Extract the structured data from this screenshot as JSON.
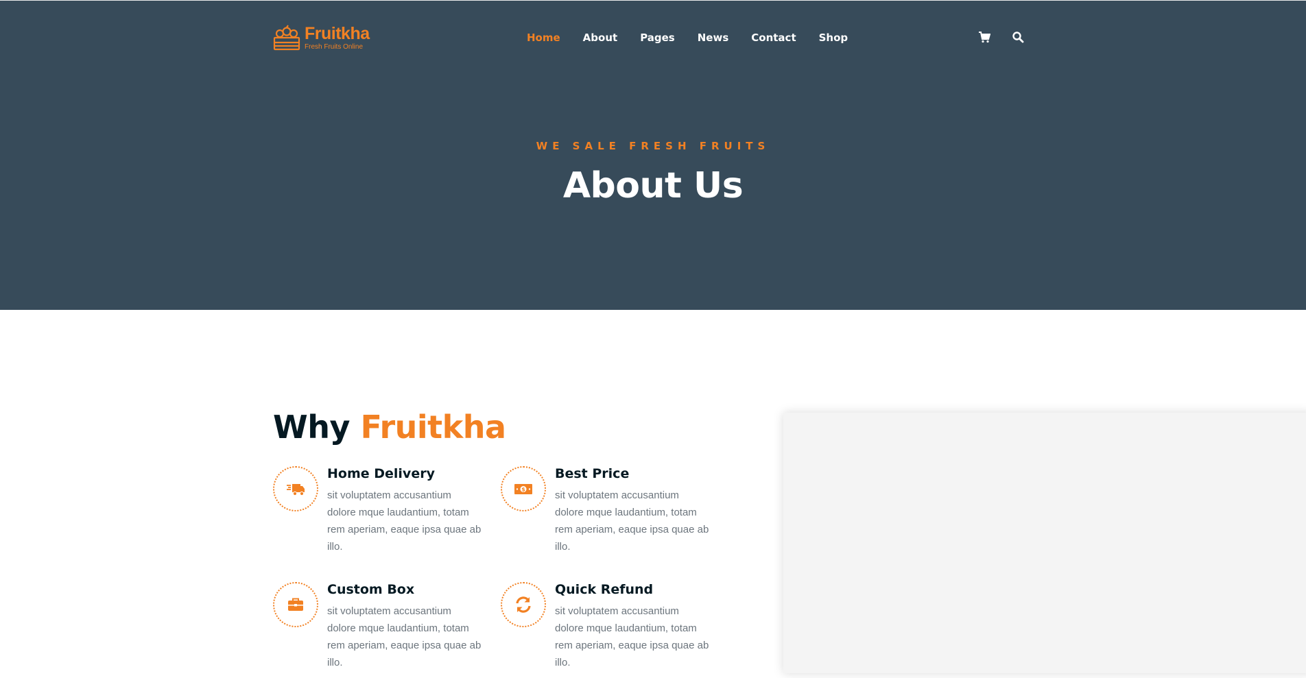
{
  "brand": {
    "name": "Fruitkha",
    "tagline": "Fresh Fruits Online",
    "accent_color": "#f28123",
    "hero_bg": "#374b5a"
  },
  "nav": {
    "items": [
      {
        "label": "Home",
        "active": true
      },
      {
        "label": "About",
        "active": false
      },
      {
        "label": "Pages",
        "active": false
      },
      {
        "label": "News",
        "active": false
      },
      {
        "label": "Contact",
        "active": false
      },
      {
        "label": "Shop",
        "active": false
      }
    ],
    "icons": [
      "shopping-cart-icon",
      "search-icon"
    ]
  },
  "hero": {
    "subtitle": "WE SALE FRESH FRUITS",
    "title": "About Us"
  },
  "why": {
    "title_prefix": "Why",
    "title_accent": "Fruitkha",
    "features": [
      {
        "icon": "truck-icon",
        "title": "Home Delivery",
        "desc": "sit voluptatem accusantium dolore mque laudantium, totam rem aperiam, eaque ipsa quae ab illo."
      },
      {
        "icon": "money-icon",
        "title": "Best Price",
        "desc": "sit voluptatem accusantium dolore mque laudantium, totam rem aperiam, eaque ipsa quae ab illo."
      },
      {
        "icon": "briefcase-icon",
        "title": "Custom Box",
        "desc": "sit voluptatem accusantium dolore mque laudantium, totam rem aperiam, eaque ipsa quae ab illo."
      },
      {
        "icon": "refresh-icon",
        "title": "Quick Refund",
        "desc": "sit voluptatem accusantium dolore mque laudantium, totam rem aperiam, eaque ipsa quae ab illo."
      }
    ]
  }
}
